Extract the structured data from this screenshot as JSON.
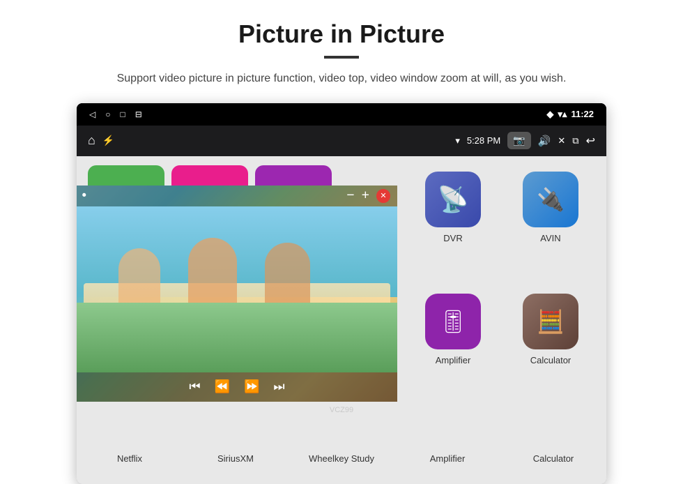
{
  "header": {
    "title": "Picture in Picture",
    "subtitle": "Support video picture in picture function, video top, video window zoom at will, as you wish."
  },
  "status_bar": {
    "back_icon": "◁",
    "home_icon": "○",
    "square_icon": "□",
    "bookmark_icon": "⊟",
    "signal_icon": "▾▴",
    "wifi_icon": "▾",
    "time": "11:22"
  },
  "toolbar": {
    "home_icon": "⌂",
    "usb_icon": "⚡",
    "wifi_label": "5:28 PM",
    "cam_icon": "📷",
    "volume_icon": "🔊",
    "close_icon": "✕",
    "windows_icon": "⧉",
    "back_icon": "↩"
  },
  "pip": {
    "record_icon": "⏺",
    "minus_label": "−",
    "plus_label": "+",
    "close_label": "✕",
    "prev_icon": "⏮",
    "rewind_icon": "⏪",
    "forward_icon": "⏩",
    "next_icon": "⏭"
  },
  "partial_icons": {
    "netflix_color": "#4caf50",
    "siriusxm_color": "#e91e8c",
    "wheelkey_color": "#9c27b0"
  },
  "apps": [
    {
      "id": "dvr",
      "label": "DVR",
      "bg_color": "#3949ab",
      "icon": "📡"
    },
    {
      "id": "avin",
      "label": "AVIN",
      "bg_color": "#1976d2",
      "icon": "🎥"
    },
    {
      "id": "amplifier",
      "label": "Amplifier",
      "bg_color": "#8e24aa",
      "icon": "🎚"
    },
    {
      "id": "calculator",
      "label": "Calculator",
      "bg_color": "#5d4037",
      "icon": "🧮"
    }
  ],
  "bottom_labels": [
    "Netflix",
    "SiriusXM",
    "Wheelkey Study",
    "Amplifier",
    "Calculator"
  ],
  "watermark": "VCZ99"
}
